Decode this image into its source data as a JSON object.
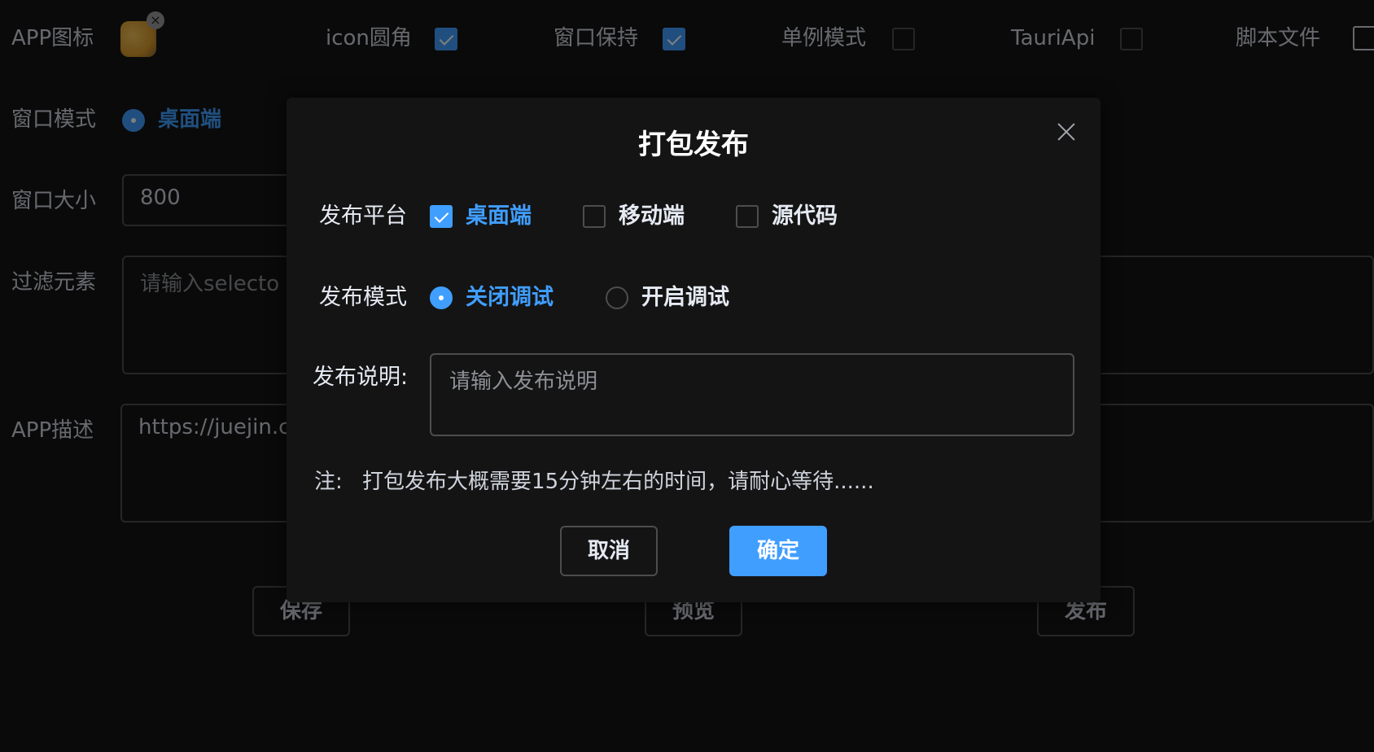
{
  "form": {
    "app_icon_label": "APP图标",
    "icon_round_label": "icon圆角",
    "icon_round_checked": true,
    "window_keep_label": "窗口保持",
    "window_keep_checked": true,
    "singleton_label": "单例模式",
    "singleton_checked": false,
    "tauri_api_label": "TauriApi",
    "tauri_api_checked": false,
    "script_file_label": "脚本文件",
    "window_mode_label": "窗口模式",
    "window_mode_selected": "桌面端",
    "window_size_label": "窗口大小",
    "window_size_value": "800",
    "filter_label": "过滤元素",
    "filter_placeholder": "请输入selecto",
    "app_desc_label": "APP描述",
    "app_desc_value": "https://juejin.c",
    "save_button": "保存",
    "preview_button": "预览",
    "publish_button": "发布"
  },
  "dialog": {
    "title": "打包发布",
    "platform_label": "发布平台",
    "platforms": [
      {
        "label": "桌面端",
        "checked": true
      },
      {
        "label": "移动端",
        "checked": false
      },
      {
        "label": "源代码",
        "checked": false
      }
    ],
    "mode_label": "发布模式",
    "modes": [
      {
        "label": "关闭调试",
        "selected": true
      },
      {
        "label": "开启调试",
        "selected": false
      }
    ],
    "desc_label": "发布说明:",
    "desc_placeholder": "请输入发布说明",
    "note_prefix": "注:",
    "note_text": "打包发布大概需要15分钟左右的时间，请耐心等待......",
    "cancel_button": "取消",
    "confirm_button": "确定"
  },
  "colors": {
    "accent": "#409eff",
    "background": "#141414",
    "border": "#4c4d4f"
  }
}
